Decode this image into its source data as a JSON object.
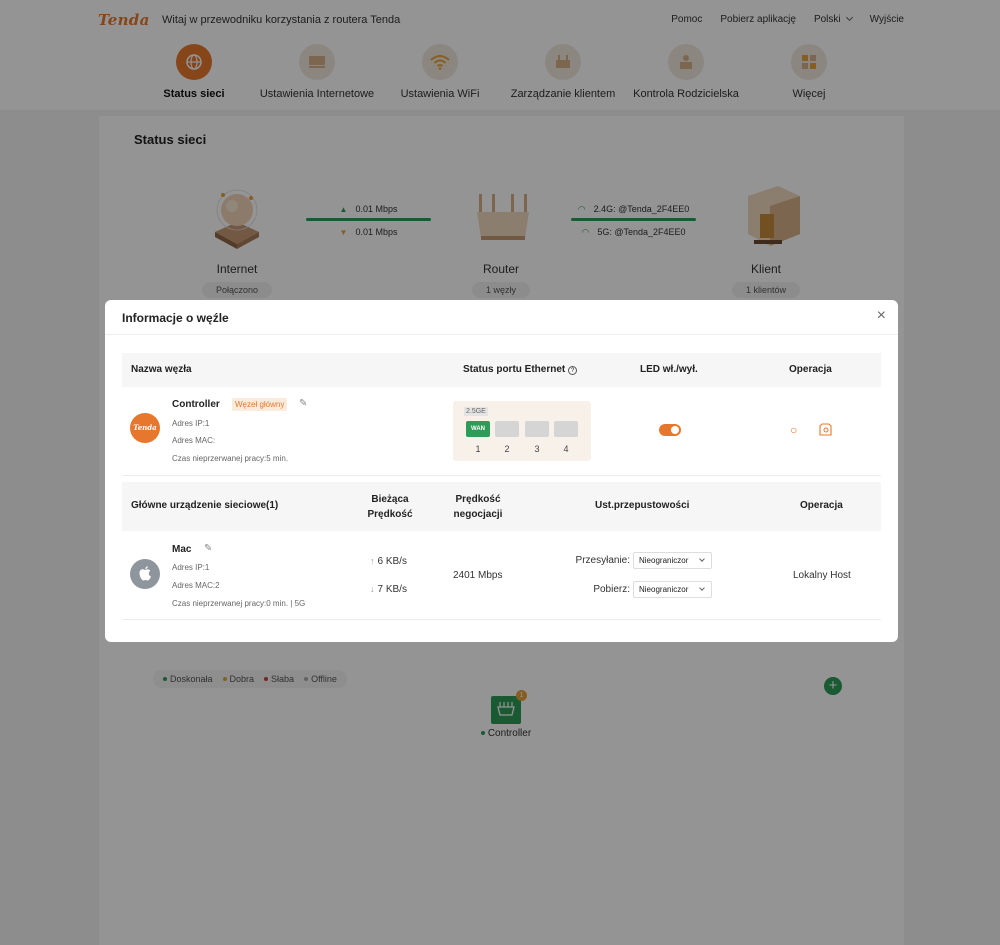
{
  "header": {
    "logo": "Tenda",
    "welcome": "Witaj w przewodniku korzystania z routera Tenda",
    "links": {
      "help": "Pomoc",
      "download_app": "Pobierz aplikację",
      "language": "Polski",
      "logout": "Wyjście"
    }
  },
  "nav": [
    {
      "label": "Status sieci",
      "icon": "globe-icon",
      "active": true
    },
    {
      "label": "Ustawienia Internetowe",
      "icon": "internet-settings-icon"
    },
    {
      "label": "Ustawienia WiFi",
      "icon": "wifi-icon"
    },
    {
      "label": "Zarządzanie klientem",
      "icon": "client-management-icon"
    },
    {
      "label": "Kontrola Rodzicielska",
      "icon": "parental-control-icon"
    },
    {
      "label": "Więcej",
      "icon": "more-icon"
    }
  ],
  "status": {
    "title": "Status sieci",
    "internet": {
      "name": "Internet",
      "state": "Połączono"
    },
    "upload": "0.01 Mbps",
    "download": "0.01 Mbps",
    "router": {
      "name": "Router",
      "state": "1 węzły"
    },
    "ssid_24": "2.4G: @Tenda_2F4EE0",
    "ssid_5": "5G: @Tenda_2F4EE0",
    "client": {
      "name": "Klient",
      "state": "1 klientów"
    }
  },
  "legend": {
    "excellent": "Doskonała",
    "good": "Dobra",
    "weak": "Słaba",
    "offline": "Offline"
  },
  "legend_colors": {
    "excellent": "#2e9b58",
    "good": "#e8a23c",
    "weak": "#d93a2b",
    "offline": "#aaaaaa"
  },
  "topology": {
    "node_label": "Controller",
    "badge": "1"
  },
  "modal": {
    "title": "Informacje o węźle",
    "close": "×",
    "node_table": {
      "headers": {
        "name": "Nazwa węzła",
        "eth_status": "Status portu Ethernet",
        "led": "LED wł./wył.",
        "operation": "Operacja"
      },
      "node": {
        "avatar_text": "Tenda",
        "name": "Controller",
        "badge": "Węzeł główny",
        "ip": "Adres IP:1",
        "mac": "Adres MAC:",
        "uptime": "Czas nieprzerwanej pracy:5 min.",
        "ge_label": "2.5GE",
        "wan_label": "WAN",
        "ports": [
          "1",
          "2",
          "3",
          "4"
        ],
        "led_on": true
      }
    },
    "device_table": {
      "headers": {
        "device": "Główne urządzenie sieciowe(1)",
        "speed_1": "Bieżąca",
        "speed_2": "Prędkość",
        "nego_1": "Prędkość",
        "nego_2": "negocjacji",
        "bandwidth": "Ust.przepustowości",
        "operation": "Operacja"
      },
      "device": {
        "name": "Mac",
        "ip": "Adres IP:1",
        "mac": "Adres MAC:2",
        "uptime": "Czas nieprzerwanej pracy:0 min. | 5G",
        "up_speed": "6 KB/s",
        "down_speed": "7 KB/s",
        "negotiated": "2401 Mbps",
        "upload_label": "Przesyłanie:",
        "upload_value": "Nieograniczor",
        "download_label": "Pobierz:",
        "download_value": "Nieograniczor",
        "operation": "Lokalny Host"
      }
    }
  }
}
